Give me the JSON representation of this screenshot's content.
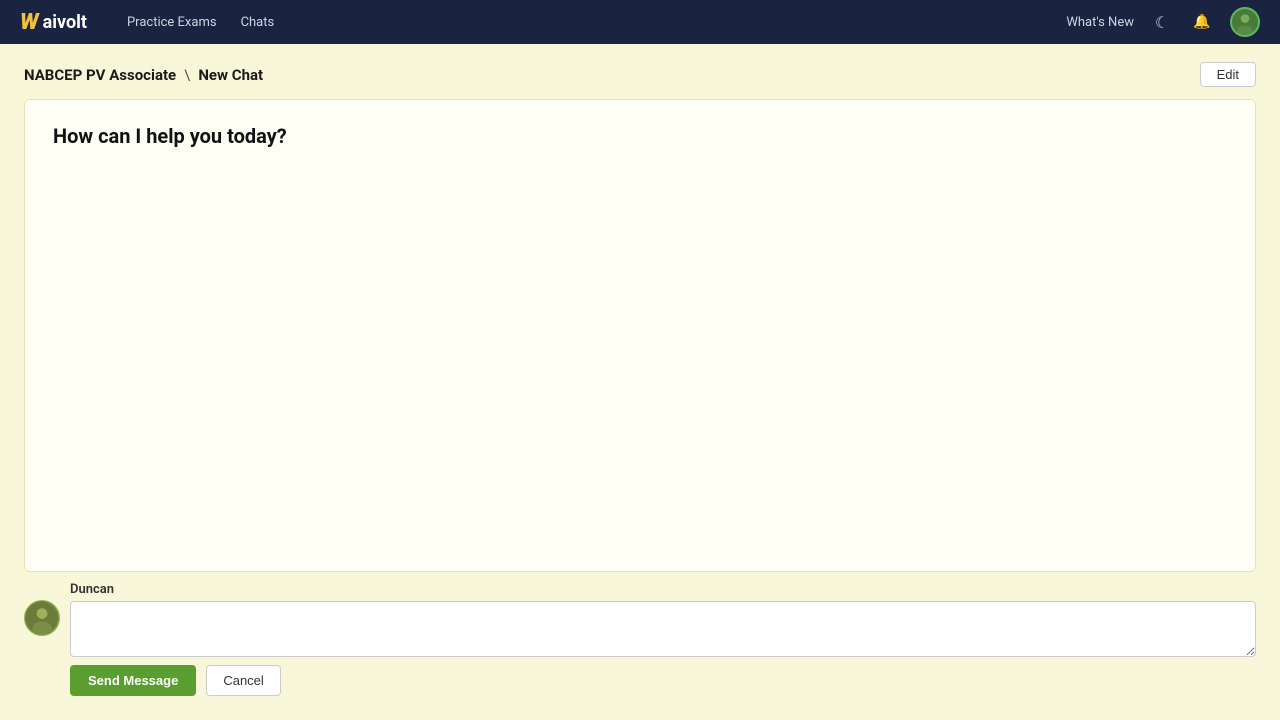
{
  "nav": {
    "logo_w": "W",
    "logo_text": "aivolt",
    "links": [
      {
        "label": "Practice Exams",
        "name": "practice-exams-link"
      },
      {
        "label": "Chats",
        "name": "chats-link"
      }
    ],
    "whats_new": "What's New"
  },
  "breadcrumb": {
    "parent": "NABCEP PV Associate",
    "separator": "\\",
    "current": "New Chat"
  },
  "edit_button": "Edit",
  "chat": {
    "greeting": "How can I help you today?"
  },
  "input": {
    "username": "Duncan",
    "placeholder": "",
    "send_label": "Send Message",
    "cancel_label": "Cancel"
  }
}
